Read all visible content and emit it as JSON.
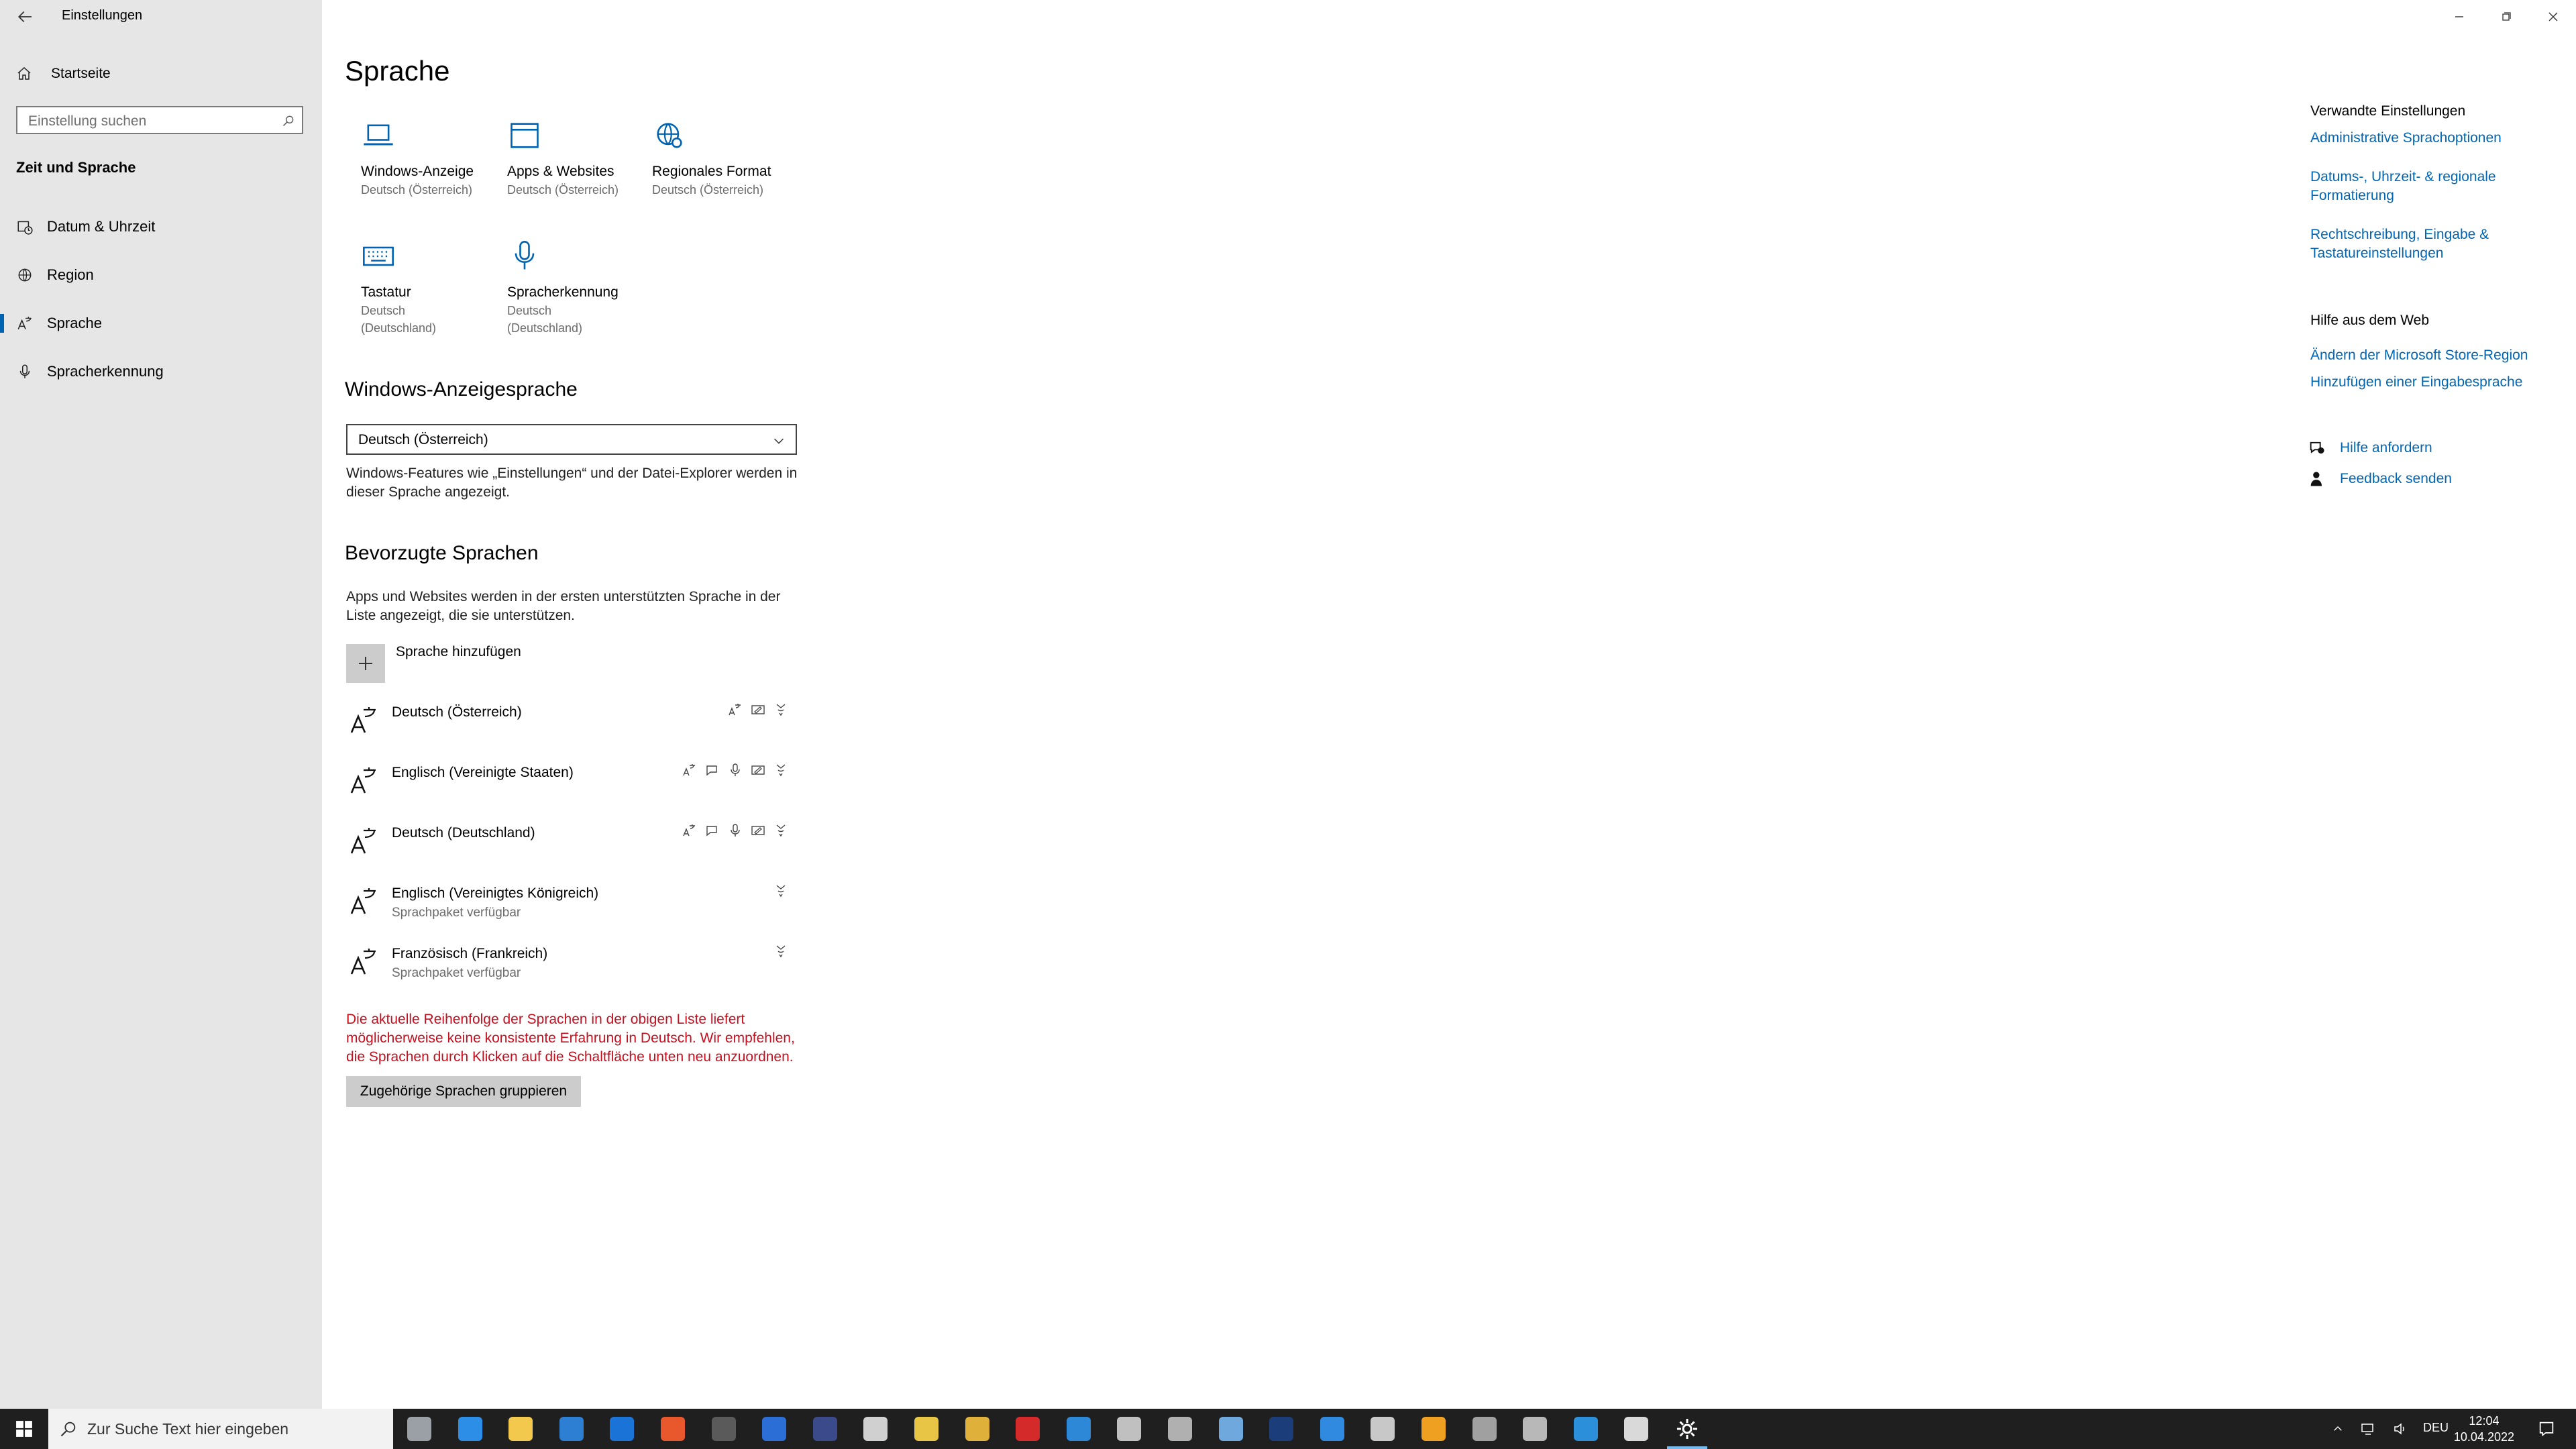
{
  "window": {
    "title": "Einstellungen"
  },
  "sidebar": {
    "home": "Startseite",
    "search_placeholder": "Einstellung suchen",
    "section": "Zeit und Sprache",
    "items": [
      {
        "label": "Datum & Uhrzeit",
        "icon": "calendar-clock-icon"
      },
      {
        "label": "Region",
        "icon": "globe-icon"
      },
      {
        "label": "Sprache",
        "icon": "language-icon",
        "active": true
      },
      {
        "label": "Spracherkennung",
        "icon": "microphone-icon"
      }
    ]
  },
  "main": {
    "title": "Sprache",
    "tiles": [
      {
        "title": "Windows-Anzeige",
        "sub": "Deutsch (Österreich)",
        "icon": "laptop-icon"
      },
      {
        "title": "Apps & Websites",
        "sub": "Deutsch (Österreich)",
        "icon": "window-icon"
      },
      {
        "title": "Regionales Format",
        "sub": "Deutsch (Österreich)",
        "icon": "globe-settings-icon"
      },
      {
        "title": "Tastatur",
        "sub": "Deutsch (Deutschland)",
        "icon": "keyboard-icon"
      },
      {
        "title": "Spracherkennung",
        "sub": "Deutsch (Deutschland)",
        "icon": "microphone-icon"
      }
    ],
    "display_language": {
      "heading": "Windows-Anzeigesprache",
      "selected": "Deutsch (Österreich)",
      "description": "Windows-Features wie „Einstellungen“ und der Datei-Explorer werden in dieser Sprache angezeigt."
    },
    "preferred": {
      "heading": "Bevorzugte Sprachen",
      "description": "Apps und Websites werden in der ersten unterstützten Sprache in der Liste angezeigt, die sie unterstützen.",
      "add_label": "Sprache hinzufügen",
      "languages": [
        {
          "name": "Deutsch (Österreich)",
          "sub": "",
          "features": [
            "display-language-icon",
            "handwriting-icon",
            "text-to-speech-icon"
          ]
        },
        {
          "name": "Englisch (Vereinigte Staaten)",
          "sub": "",
          "features": [
            "display-language-icon",
            "speech-icon",
            "microphone-icon",
            "handwriting-icon",
            "text-to-speech-icon"
          ]
        },
        {
          "name": "Deutsch (Deutschland)",
          "sub": "",
          "features": [
            "display-language-icon",
            "speech-icon",
            "microphone-icon",
            "handwriting-icon",
            "text-to-speech-icon"
          ]
        },
        {
          "name": "Englisch (Vereinigtes Königreich)",
          "sub": "Sprachpaket verfügbar",
          "features": [
            "text-to-speech-icon"
          ]
        },
        {
          "name": "Französisch (Frankreich)",
          "sub": "Sprachpaket verfügbar",
          "features": [
            "text-to-speech-icon"
          ]
        }
      ],
      "warning": "Die aktuelle Reihenfolge der Sprachen in der obigen Liste liefert möglicherweise keine konsistente Erfahrung in Deutsch. Wir empfehlen, die Sprachen durch Klicken auf die Schaltfläche unten neu anzuordnen.",
      "group_button": "Zugehörige Sprachen gruppieren"
    }
  },
  "related": {
    "heading": "Verwandte Einstellungen",
    "links": [
      "Administrative Sprachoptionen",
      "Datums-, Uhrzeit- & regionale Formatierung",
      "Rechtschreibung, Eingabe & Tastatureinstellungen"
    ],
    "web_heading": "Hilfe aus dem Web",
    "web_links": [
      "Ändern der Microsoft Store-Region",
      "Hinzufügen einer Eingabesprache"
    ],
    "help": "Hilfe anfordern",
    "feedback": "Feedback senden"
  },
  "taskbar": {
    "search_placeholder": "Zur Suche Text hier eingeben",
    "language": "DEU",
    "time": "12:04",
    "date": "10.04.2022",
    "apps": [
      {
        "name": "task-view-icon",
        "color": "#9aa0a6"
      },
      {
        "name": "edge-icon",
        "color": "#2c8ee6"
      },
      {
        "name": "file-explorer-icon",
        "color": "#f2c94c"
      },
      {
        "name": "store-icon",
        "color": "#2d7fd3"
      },
      {
        "name": "mail-icon",
        "color": "#1a73d6"
      },
      {
        "name": "firefox-icon",
        "color": "#e8582c"
      },
      {
        "name": "app-icon-1",
        "color": "#5a5a5a"
      },
      {
        "name": "app-icon-2",
        "color": "#2b6fd6"
      },
      {
        "name": "app-icon-3",
        "color": "#3b4a8a"
      },
      {
        "name": "app-icon-4",
        "color": "#d0d0d0"
      },
      {
        "name": "app-icon-5",
        "color": "#e8c545"
      },
      {
        "name": "notes-icon",
        "color": "#e0b13a"
      },
      {
        "name": "app-icon-6",
        "color": "#d42a2a"
      },
      {
        "name": "app-icon-7",
        "color": "#2d88d8"
      },
      {
        "name": "app-icon-8",
        "color": "#c0c0c0"
      },
      {
        "name": "app-icon-9",
        "color": "#b0b0b0"
      },
      {
        "name": "steam-icon",
        "color": "#6ea8dc"
      },
      {
        "name": "app-icon-10",
        "color": "#1b3d7a"
      },
      {
        "name": "app-icon-11",
        "color": "#2f8ae0"
      },
      {
        "name": "app-icon-12",
        "color": "#c8c8c8"
      },
      {
        "name": "app-icon-13",
        "color": "#f0a020"
      },
      {
        "name": "app-icon-14",
        "color": "#a0a0a0"
      },
      {
        "name": "app-icon-15",
        "color": "#b8b8b8"
      },
      {
        "name": "app-icon-16",
        "color": "#2b90d9"
      },
      {
        "name": "app-icon-17",
        "color": "#d9d9d9"
      },
      {
        "name": "settings-icon",
        "color": "#ffffff",
        "active": true
      }
    ]
  },
  "colors": {
    "accent": "#0063b1",
    "link": "#0066b4",
    "warning": "#c50f1f",
    "sidebar": "#e6e6e6"
  }
}
